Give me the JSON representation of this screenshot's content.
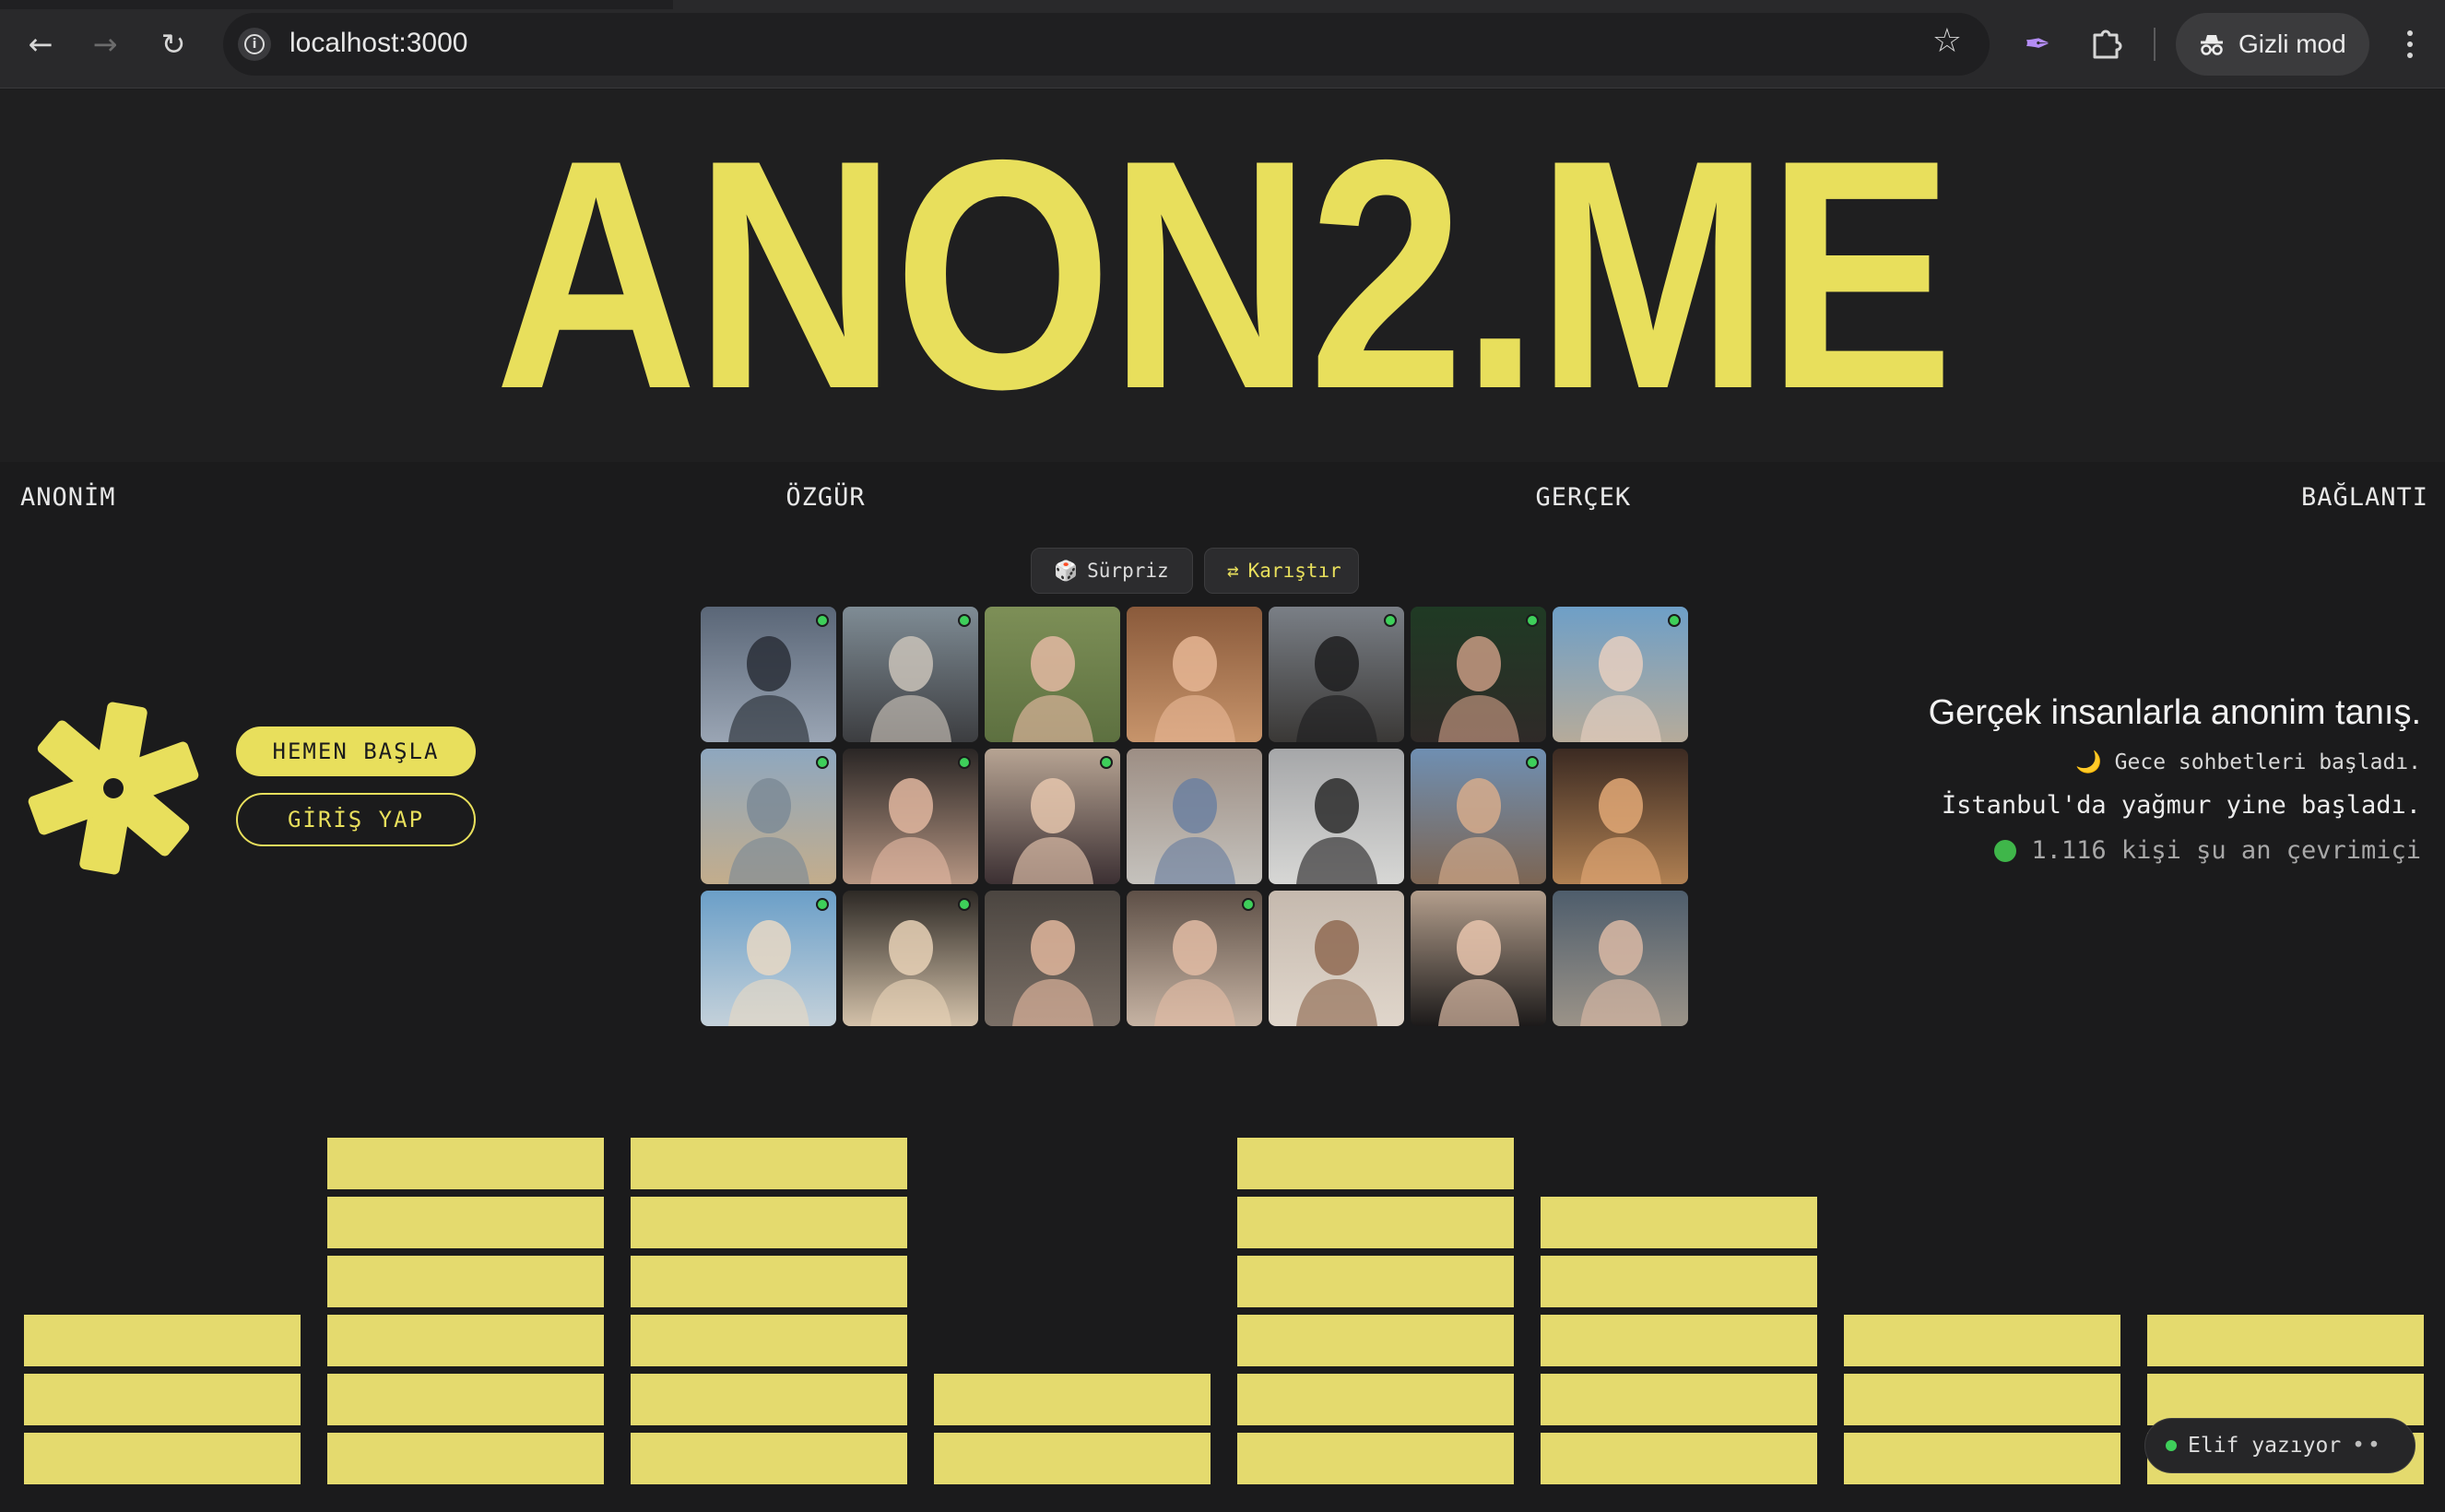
{
  "browser": {
    "url": "localhost:3000",
    "incognito_label": "Gizli mod",
    "icons": [
      "back-icon",
      "forward-icon",
      "reload-icon",
      "info-icon",
      "star-icon",
      "feather-icon",
      "puzzle-icon",
      "incognito-icon",
      "kebab-menu-icon"
    ]
  },
  "site": {
    "logo": "ANON2.ME",
    "taglines": [
      "ANONİM",
      "ÖZGÜR",
      "GERÇEK",
      "BAĞLANTI"
    ],
    "controls": {
      "surprise_icon": "🎲",
      "surprise_label": "Sürpriz",
      "shuffle_icon": "⇄",
      "shuffle_label": "Karıştır"
    },
    "cta": {
      "start_label": "HEMEN BAŞLA",
      "login_label": "GİRİŞ YAP"
    },
    "info": {
      "headline": "Gerçek insanlarla anonim tanış.",
      "night_icon": "🌙",
      "night_text": "Gece sohbetleri başladı.",
      "rain_text": "İstanbul'da yağmur yine başladı.",
      "online_text": "1.116 kişi şu an çevrimiçi"
    },
    "profiles": [
      {
        "online": true,
        "top": "#5a6677",
        "bottom": "#9aa5b4",
        "figure": "#2a2f38"
      },
      {
        "online": true,
        "top": "#7f8c95",
        "bottom": "#3c3d40",
        "figure": "#c9c2b8"
      },
      {
        "online": false,
        "top": "#7d8f57",
        "bottom": "#5d7040",
        "figure": "#e3b9a2"
      },
      {
        "online": false,
        "top": "#8a5a3b",
        "bottom": "#c7946b",
        "figure": "#e6b694"
      },
      {
        "online": true,
        "top": "#7a7f86",
        "bottom": "#3a3836",
        "figure": "#1e1e20"
      },
      {
        "online": true,
        "top": "#1f3a24",
        "bottom": "#2f2a28",
        "figure": "#c79a83"
      },
      {
        "online": true,
        "top": "#6e9fc7",
        "bottom": "#b6ab9a",
        "figure": "#e6cfc0"
      },
      {
        "online": true,
        "top": "#8ea7bf",
        "bottom": "#c3ad8c",
        "figure": "#7c8b97"
      },
      {
        "online": true,
        "top": "#2a2625",
        "bottom": "#b59582",
        "figure": "#e0b69f"
      },
      {
        "online": true,
        "top": "#b7a493",
        "bottom": "#3c3033",
        "figure": "#e5c5ad"
      },
      {
        "online": false,
        "top": "#9d8e84",
        "bottom": "#c5c2bd",
        "figure": "#6c80a0"
      },
      {
        "online": false,
        "top": "#a6a7a9",
        "bottom": "#d7d7d5",
        "figure": "#2c2b2c"
      },
      {
        "online": true,
        "top": "#6f8fb2",
        "bottom": "#7c6553",
        "figure": "#d6ac8c"
      },
      {
        "online": false,
        "top": "#3b2a22",
        "bottom": "#b08052",
        "figure": "#e2a875"
      },
      {
        "online": true,
        "top": "#6b9fc8",
        "bottom": "#c4d1da",
        "figure": "#e7d8c4"
      },
      {
        "online": true,
        "top": "#2d2925",
        "bottom": "#d4c2aa",
        "figure": "#e7d1b6"
      },
      {
        "online": false,
        "top": "#4b4540",
        "bottom": "#7a6f66",
        "figure": "#e1b69c"
      },
      {
        "online": true,
        "top": "#5e5047",
        "bottom": "#c6b3a3",
        "figure": "#e2bca4"
      },
      {
        "online": false,
        "top": "#c5b9ae",
        "bottom": "#e0d6cb",
        "figure": "#8f6a52"
      },
      {
        "online": false,
        "top": "#b39e8c",
        "bottom": "#1c1a1a",
        "figure": "#e7c4ad"
      },
      {
        "online": false,
        "top": "#4e5d6c",
        "bottom": "#9b9388",
        "figure": "#d9b8a4"
      }
    ],
    "equalizer": [
      3,
      6,
      6,
      2,
      6,
      5,
      3,
      3
    ],
    "typing_indicator": "Elif yazıyor",
    "typing_dots": "••",
    "accent": "#e8df5c"
  }
}
